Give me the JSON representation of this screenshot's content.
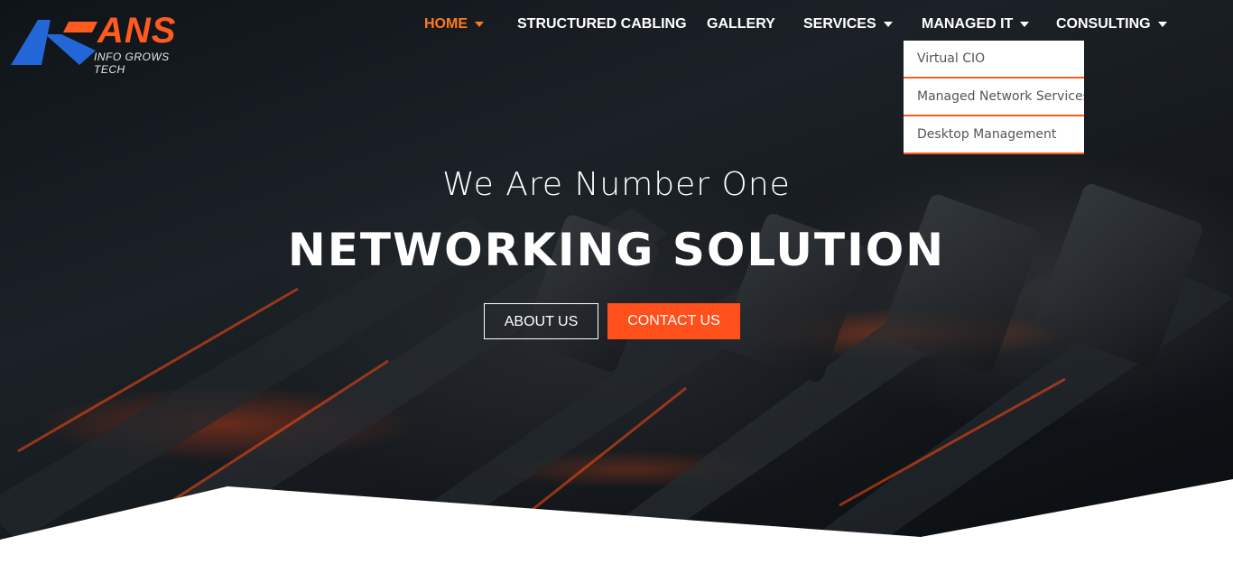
{
  "logo": {
    "brand": "ANS",
    "tagline": "INFO GROWS TECH",
    "icon": "logo-mark"
  },
  "nav": {
    "items": [
      {
        "label": "HOME",
        "active": true,
        "has_dropdown": true
      },
      {
        "label": "STRUCTURED CABLING",
        "active": false,
        "has_dropdown": false
      },
      {
        "label": "GALLERY",
        "active": false,
        "has_dropdown": false
      },
      {
        "label": "SERVICES",
        "active": false,
        "has_dropdown": true
      },
      {
        "label": "MANAGED IT",
        "active": false,
        "has_dropdown": true
      },
      {
        "label": "CONSULTING",
        "active": false,
        "has_dropdown": true
      }
    ],
    "dropdown": [
      "Virtual CIO",
      "Managed Network Services",
      "Desktop Management"
    ]
  },
  "hero": {
    "subtitle": "We Are Number One",
    "title": "NETWORKING SOLUTION",
    "about_button": "ABOUT US",
    "contact_button": "CONTACT US"
  },
  "colors": {
    "accent": "#ff5a1f",
    "active_nav": "#ff7a1a",
    "contact_button": "#ff4f1a"
  }
}
